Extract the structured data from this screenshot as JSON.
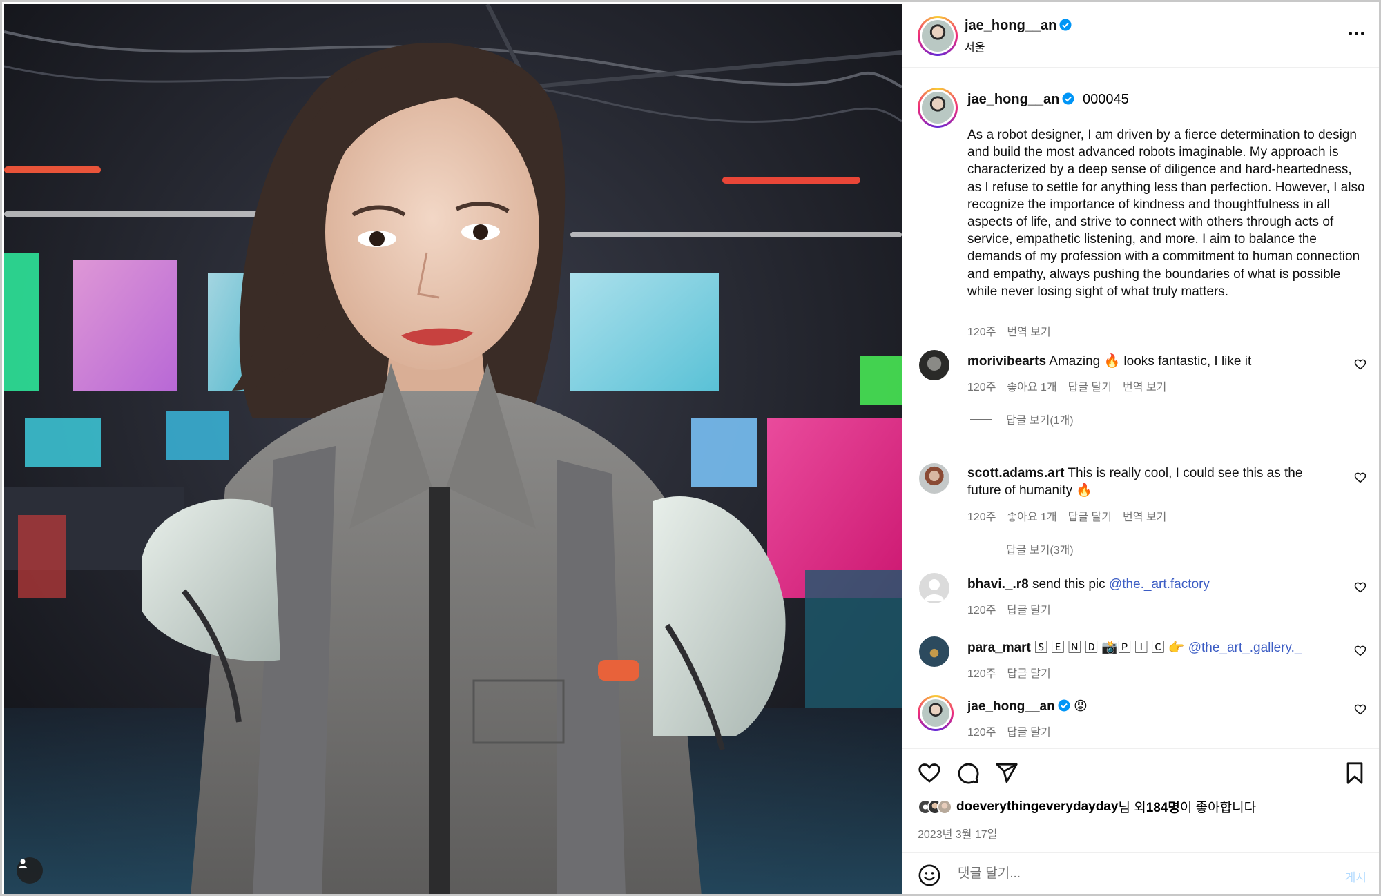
{
  "post": {
    "author": "jae_hong__an",
    "location": "서울",
    "caption_suffix": "000045",
    "caption": "As a robot designer, I am driven by a fierce determination to design and build the most advanced robots imaginable. My approach is characterized by a deep sense of diligence and hard-heartedness, as I refuse to settle for anything less than perfection. However, I also recognize the importance of kindness and thoughtfulness in all aspects of life, and strive to connect with others through acts of service, empathetic listening, and more. I aim to balance the demands of my profession with a commitment to human connection and empathy, always pushing the boundaries of what is possible while never losing sight of what truly matters.",
    "caption_time": "120주",
    "caption_translate": "번역 보기",
    "likes_user": "doeverythingeverydayday",
    "likes_text_1": "님 외 ",
    "likes_count": "184명",
    "likes_text_2": "이 좋아합니다",
    "date": "2023년 3월 17일"
  },
  "comments": [
    {
      "user": "morivibearts",
      "text_before": "Amazing ",
      "emoji": "🔥",
      "text_after": " looks fantastic, I like it",
      "time": "120주",
      "likes": "좋아요 1개",
      "reply": "답글 달기",
      "translate": "번역 보기",
      "view_replies": "답글 보기(1개)"
    },
    {
      "user": "scott.adams.art",
      "text_before": "This is really cool, I could see this as the future of humanity ",
      "emoji": "🔥",
      "time": "120주",
      "likes": "좋아요 1개",
      "reply": "답글 달기",
      "translate": "번역 보기",
      "view_replies": "답글 보기(3개)"
    },
    {
      "user": "bhavi._.r8",
      "text_before": "send this pic ",
      "mention": "@the._art.factory",
      "time": "120주",
      "reply": "답글 달기"
    },
    {
      "user": "para_mart",
      "text_before": "🅂 🄴 🄽 🄳 📸🄿 🄸 🄲  👉 ",
      "mention": "@the_art_.gallery._",
      "time": "120주",
      "reply": "답글 달기"
    },
    {
      "user": "jae_hong__an",
      "emoji": "😡",
      "time": "120주",
      "reply": "답글 달기"
    }
  ],
  "compose": {
    "placeholder": "댓글 달기...",
    "post_label": "게시"
  },
  "colors": {
    "link": "#00376b",
    "mention": "#3b5cc4",
    "verified": "#0095f6",
    "muted": "#737373",
    "post_disabled": "#b3dbff"
  },
  "icons": [
    "more-icon",
    "verified-icon",
    "heart-icon",
    "comment-icon",
    "share-icon",
    "bookmark-icon",
    "smile-icon",
    "user-tag-icon"
  ]
}
